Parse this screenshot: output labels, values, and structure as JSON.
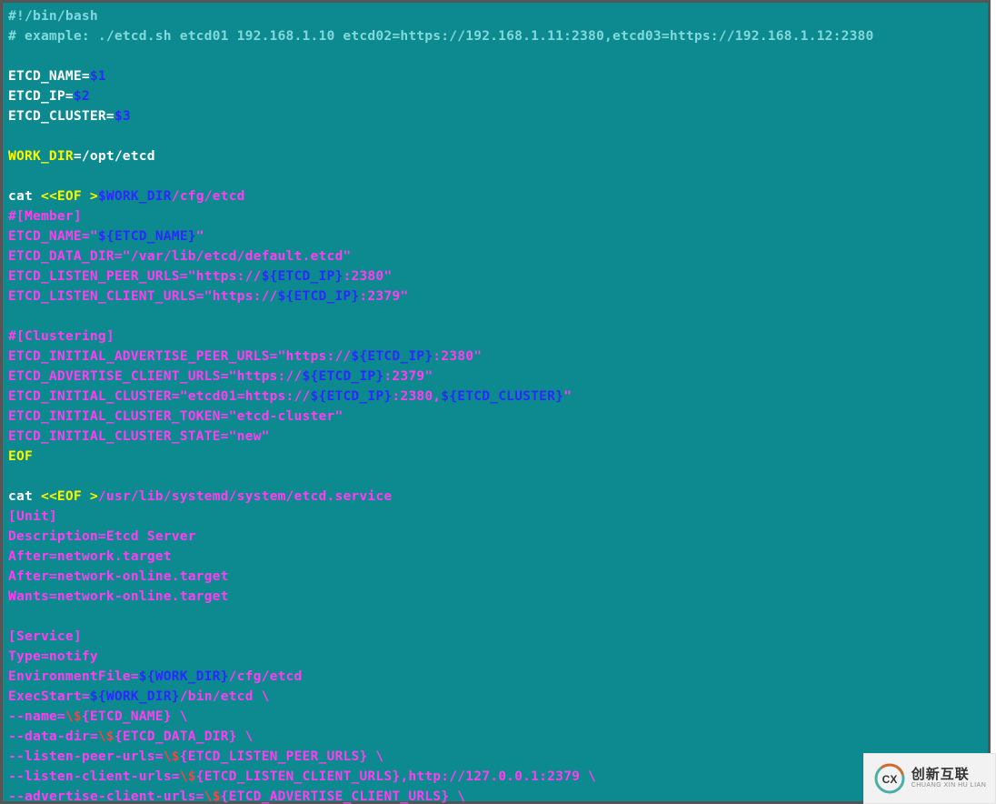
{
  "lines": [
    {
      "segs": [
        {
          "c": "c-comment",
          "t": "#!/bin/bash"
        }
      ]
    },
    {
      "segs": [
        {
          "c": "c-comment",
          "t": "# example: ./etcd.sh etcd01 192.168.1.10 etcd02=https://192.168.1.11:2380,etcd03=https://192.168.1.12:2380"
        }
      ]
    },
    {
      "segs": [
        {
          "c": "c-white",
          "t": ""
        }
      ]
    },
    {
      "segs": [
        {
          "c": "c-white",
          "t": "ETCD_NAME="
        },
        {
          "c": "c-blue",
          "t": "$1"
        }
      ]
    },
    {
      "segs": [
        {
          "c": "c-white",
          "t": "ETCD_IP="
        },
        {
          "c": "c-blue",
          "t": "$2"
        }
      ]
    },
    {
      "segs": [
        {
          "c": "c-white",
          "t": "ETCD_CLUSTER="
        },
        {
          "c": "c-blue",
          "t": "$3"
        }
      ]
    },
    {
      "segs": [
        {
          "c": "c-white",
          "t": ""
        }
      ]
    },
    {
      "segs": [
        {
          "c": "c-yellow",
          "t": "WORK_DIR"
        },
        {
          "c": "c-white",
          "t": "=/opt/etcd"
        }
      ]
    },
    {
      "segs": [
        {
          "c": "c-white",
          "t": ""
        }
      ]
    },
    {
      "segs": [
        {
          "c": "c-white",
          "t": "cat "
        },
        {
          "c": "c-yellow",
          "t": "<<EOF >"
        },
        {
          "c": "c-blue",
          "t": "$WORK_DIR"
        },
        {
          "c": "c-magenta",
          "t": "/cfg/etcd"
        }
      ]
    },
    {
      "segs": [
        {
          "c": "c-magenta",
          "t": "#[Member]"
        }
      ]
    },
    {
      "segs": [
        {
          "c": "c-magenta",
          "t": "ETCD_NAME=\""
        },
        {
          "c": "c-blue",
          "t": "${ETCD_NAME}"
        },
        {
          "c": "c-magenta",
          "t": "\""
        }
      ]
    },
    {
      "segs": [
        {
          "c": "c-magenta",
          "t": "ETCD_DATA_DIR=\"/var/lib/etcd/default.etcd\""
        }
      ]
    },
    {
      "segs": [
        {
          "c": "c-magenta",
          "t": "ETCD_LISTEN_PEER_URLS=\"https://"
        },
        {
          "c": "c-blue",
          "t": "${ETCD_IP}"
        },
        {
          "c": "c-magenta",
          "t": ":2380\""
        }
      ]
    },
    {
      "segs": [
        {
          "c": "c-magenta",
          "t": "ETCD_LISTEN_CLIENT_URLS=\"https://"
        },
        {
          "c": "c-blue",
          "t": "${ETCD_IP}"
        },
        {
          "c": "c-magenta",
          "t": ":2379\""
        }
      ]
    },
    {
      "segs": [
        {
          "c": "c-white",
          "t": ""
        }
      ]
    },
    {
      "segs": [
        {
          "c": "c-magenta",
          "t": "#[Clustering]"
        }
      ]
    },
    {
      "segs": [
        {
          "c": "c-magenta",
          "t": "ETCD_INITIAL_ADVERTISE_PEER_URLS=\"https://"
        },
        {
          "c": "c-blue",
          "t": "${ETCD_IP}"
        },
        {
          "c": "c-magenta",
          "t": ":2380\""
        }
      ]
    },
    {
      "segs": [
        {
          "c": "c-magenta",
          "t": "ETCD_ADVERTISE_CLIENT_URLS=\"https://"
        },
        {
          "c": "c-blue",
          "t": "${ETCD_IP}"
        },
        {
          "c": "c-magenta",
          "t": ":2379\""
        }
      ]
    },
    {
      "segs": [
        {
          "c": "c-magenta",
          "t": "ETCD_INITIAL_CLUSTER=\"etcd01=https://"
        },
        {
          "c": "c-blue",
          "t": "${ETCD_IP}"
        },
        {
          "c": "c-magenta",
          "t": ":2380,"
        },
        {
          "c": "c-blue",
          "t": "${ETCD_CLUSTER}"
        },
        {
          "c": "c-magenta",
          "t": "\""
        }
      ]
    },
    {
      "segs": [
        {
          "c": "c-magenta",
          "t": "ETCD_INITIAL_CLUSTER_TOKEN=\"etcd-cluster\""
        }
      ]
    },
    {
      "segs": [
        {
          "c": "c-magenta",
          "t": "ETCD_INITIAL_CLUSTER_STATE=\"new\""
        }
      ]
    },
    {
      "segs": [
        {
          "c": "c-yellow",
          "t": "EOF"
        }
      ]
    },
    {
      "segs": [
        {
          "c": "c-white",
          "t": ""
        }
      ]
    },
    {
      "segs": [
        {
          "c": "c-white",
          "t": "cat "
        },
        {
          "c": "c-yellow",
          "t": "<<EOF >"
        },
        {
          "c": "c-magenta",
          "t": "/usr/lib/systemd/system/etcd.service"
        }
      ]
    },
    {
      "segs": [
        {
          "c": "c-magenta",
          "t": "[Unit]"
        }
      ]
    },
    {
      "segs": [
        {
          "c": "c-magenta",
          "t": "Description=Etcd Server"
        }
      ]
    },
    {
      "segs": [
        {
          "c": "c-magenta",
          "t": "After=network.target"
        }
      ]
    },
    {
      "segs": [
        {
          "c": "c-magenta",
          "t": "After=network-online.target"
        }
      ]
    },
    {
      "segs": [
        {
          "c": "c-magenta",
          "t": "Wants=network-online.target"
        }
      ]
    },
    {
      "segs": [
        {
          "c": "c-white",
          "t": ""
        }
      ]
    },
    {
      "segs": [
        {
          "c": "c-magenta",
          "t": "[Service]"
        }
      ]
    },
    {
      "segs": [
        {
          "c": "c-magenta",
          "t": "Type=notify"
        }
      ]
    },
    {
      "segs": [
        {
          "c": "c-magenta",
          "t": "EnvironmentFile="
        },
        {
          "c": "c-blue",
          "t": "${WORK_DIR}"
        },
        {
          "c": "c-magenta",
          "t": "/cfg/etcd"
        }
      ]
    },
    {
      "segs": [
        {
          "c": "c-magenta",
          "t": "ExecStart="
        },
        {
          "c": "c-blue",
          "t": "${WORK_DIR}"
        },
        {
          "c": "c-magenta",
          "t": "/bin/etcd \\"
        }
      ]
    },
    {
      "segs": [
        {
          "c": "c-magenta",
          "t": "--name="
        },
        {
          "c": "c-red",
          "t": "\\$"
        },
        {
          "c": "c-magenta",
          "t": "{ETCD_NAME} \\"
        }
      ]
    },
    {
      "segs": [
        {
          "c": "c-magenta",
          "t": "--data-dir="
        },
        {
          "c": "c-red",
          "t": "\\$"
        },
        {
          "c": "c-magenta",
          "t": "{ETCD_DATA_DIR} \\"
        }
      ]
    },
    {
      "segs": [
        {
          "c": "c-magenta",
          "t": "--listen-peer-urls="
        },
        {
          "c": "c-red",
          "t": "\\$"
        },
        {
          "c": "c-magenta",
          "t": "{ETCD_LISTEN_PEER_URLS} \\"
        }
      ]
    },
    {
      "segs": [
        {
          "c": "c-magenta",
          "t": "--listen-client-urls="
        },
        {
          "c": "c-red",
          "t": "\\$"
        },
        {
          "c": "c-magenta",
          "t": "{ETCD_LISTEN_CLIENT_URLS},http://127.0.0.1:2379 \\"
        }
      ]
    },
    {
      "segs": [
        {
          "c": "c-magenta",
          "t": "--advertise-client-urls="
        },
        {
          "c": "c-red",
          "t": "\\$"
        },
        {
          "c": "c-magenta",
          "t": "{ETCD_ADVERTISE_CLIENT_URLS} \\"
        }
      ]
    }
  ],
  "watermark": {
    "cn": "创新互联",
    "en": "CHUANG XIN HU LIAN"
  }
}
